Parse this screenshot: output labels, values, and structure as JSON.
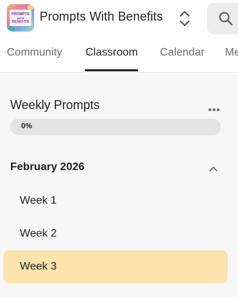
{
  "header": {
    "app_title": "Prompts With Benefits",
    "logo_text": [
      "PROMPTS",
      "WITH",
      "BENEFITS"
    ],
    "switcher_icon": "chevron-up-down-icon",
    "search_icon": "search-icon"
  },
  "tabs": [
    {
      "label": "Community",
      "active": false
    },
    {
      "label": "Classroom",
      "active": true
    },
    {
      "label": "Calendar",
      "active": false
    },
    {
      "label": "Me",
      "active": false
    }
  ],
  "course": {
    "title": "Weekly Prompts",
    "progress_label": "0%",
    "progress_value": 0,
    "more_icon": "more-horizontal-icon"
  },
  "section": {
    "title": "February 2026",
    "expanded": true,
    "toggle_icon": "chevron-up-icon",
    "lessons": [
      {
        "label": "Week 1",
        "selected": false
      },
      {
        "label": "Week 2",
        "selected": false
      },
      {
        "label": "Week 3",
        "selected": true
      }
    ]
  },
  "colors": {
    "selected_bg": "#fbe3ac",
    "progress_track": "#e3e3e3",
    "content_bg": "#f7f7f7"
  }
}
